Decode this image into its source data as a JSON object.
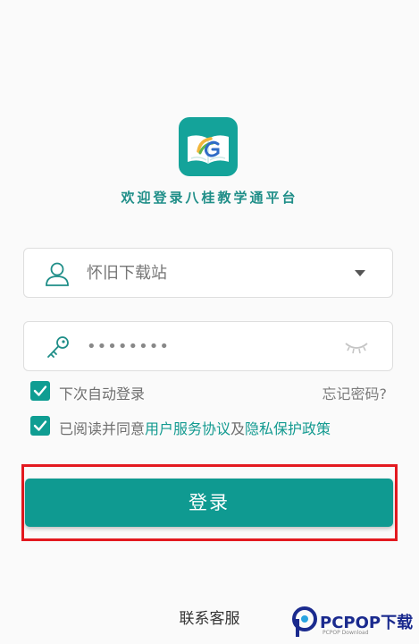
{
  "welcome_text": "欢迎登录八桂教学通平台",
  "username": {
    "value": "怀旧下载站",
    "icon": "user-icon",
    "dropdown_icon": "caret-down-icon"
  },
  "password": {
    "value": "••••••••",
    "icon": "key-icon",
    "visibility_icon": "eye-closed-icon"
  },
  "auto_login": {
    "label": "下次自动登录",
    "checked": true
  },
  "forgot_password": "忘记密码?",
  "agreement": {
    "checked": true,
    "prefix": "已阅读并同意",
    "terms_link": "用户服务协议",
    "joiner": "及",
    "privacy_link": "隐私保护政策"
  },
  "login_button": "登录",
  "customer_service": "联系客服",
  "watermark": {
    "brand": "PCPOP下载",
    "sub": "PCPOP Download"
  },
  "colors": {
    "accent": "#0f9a91",
    "highlight_border": "#e3191f"
  }
}
